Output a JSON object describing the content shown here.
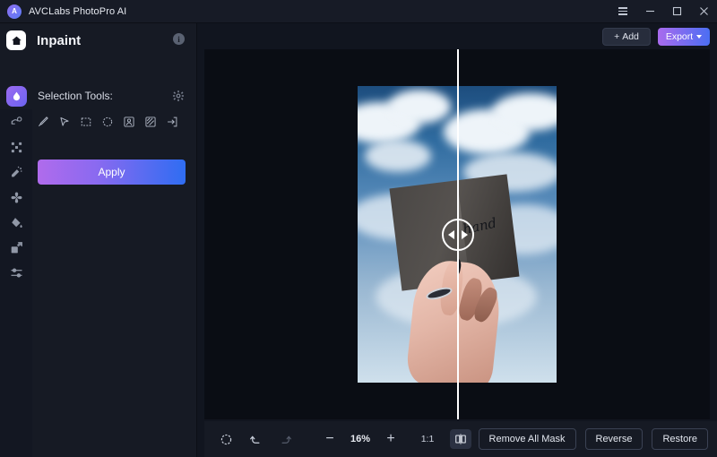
{
  "window": {
    "app_title": "AVCLabs PhotoPro AI",
    "logo_text": "A",
    "controls": {
      "menu": "menu-icon",
      "minimize": "–",
      "maximize": "□",
      "close": "✕"
    }
  },
  "sidebar": {
    "home_icon": "home-icon",
    "page_title": "Inpaint",
    "info_icon": "i",
    "selection_label": "Selection Tools:",
    "settings_icon": "gear-icon",
    "apply_label": "Apply",
    "tools": [
      {
        "name": "brush-tool",
        "icon": "brush-icon"
      },
      {
        "name": "lasso-tool",
        "icon": "cursor-icon"
      },
      {
        "name": "rectangle-select-tool",
        "icon": "rectangle-dashed-icon"
      },
      {
        "name": "ellipse-select-tool",
        "icon": "ellipse-dashed-icon"
      },
      {
        "name": "portrait-select-tool",
        "icon": "person-box-icon"
      },
      {
        "name": "texture-select-tool",
        "icon": "hatched-box-icon"
      },
      {
        "name": "import-mask-tool",
        "icon": "arrow-in-box-icon"
      }
    ],
    "rail": [
      {
        "name": "rail-item-object-removal",
        "icon": "object-remove-icon"
      },
      {
        "name": "rail-item-enhance",
        "icon": "sparkle-grid-icon"
      },
      {
        "name": "rail-item-inpaint",
        "icon": "magic-wand-icon"
      },
      {
        "name": "rail-item-retouch",
        "icon": "flower-icon"
      },
      {
        "name": "rail-item-colorize",
        "icon": "paint-bucket-icon"
      },
      {
        "name": "rail-item-resize",
        "icon": "expand-icon"
      },
      {
        "name": "rail-item-adjust",
        "icon": "sliders-icon"
      }
    ]
  },
  "header_actions": {
    "add_label": "+ Add",
    "add_plus": "+",
    "add_text": "Add",
    "export_label": "Export",
    "export_chevron": "chevron-down-icon"
  },
  "canvas": {
    "annotation_text": "hand",
    "split_handle": "split-compare-handle",
    "left_arrow": "arrow-left-icon",
    "right_arrow": "arrow-right-icon"
  },
  "bottombar": {
    "reset_icon": "reset-icon",
    "undo_icon": "undo-icon",
    "redo_icon": "redo-icon",
    "zoom_out": "−",
    "zoom_value": "16%",
    "zoom_in": "+",
    "fit_ratio": "1:1",
    "compare_icon": "split-view-icon",
    "remove_all_mask_label": "Remove All Mask",
    "reverse_label": "Reverse",
    "restore_label": "Restore"
  },
  "colors": {
    "accent_purple": "#a96bee",
    "accent_blue": "#2f6df2",
    "panel": "#161a24",
    "canvas_bg": "#0a0d14",
    "titlebar": "#171b26"
  }
}
